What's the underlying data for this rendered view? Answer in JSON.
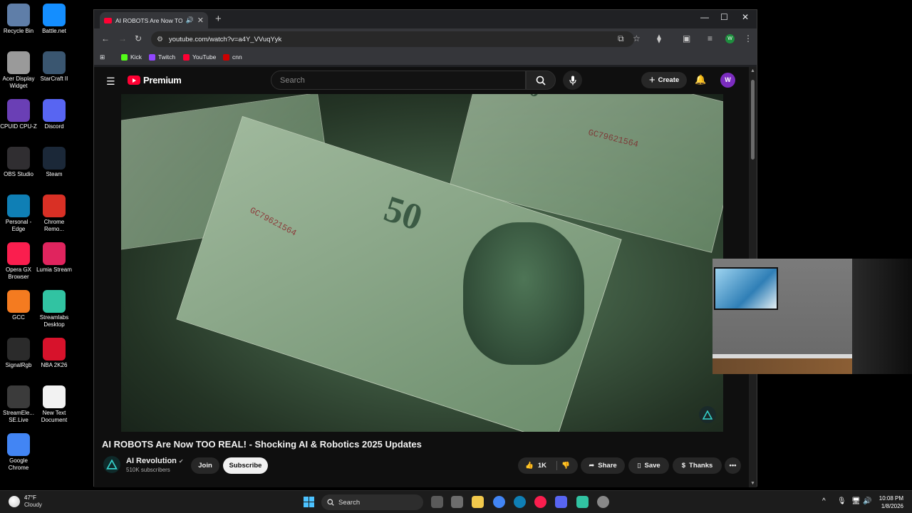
{
  "desktop": {
    "icons": [
      {
        "label": "Recycle Bin",
        "color": "#5f7ea8"
      },
      {
        "label": "Battle.net",
        "color": "#148eff"
      },
      {
        "label": "Acer Display Widget",
        "color": "#9a9a9a"
      },
      {
        "label": "StarCraft II",
        "color": "#3a5670"
      },
      {
        "label": "CPUID CPU-Z",
        "color": "#6a3fb5"
      },
      {
        "label": "Discord",
        "color": "#5865f2"
      },
      {
        "label": "OBS Studio",
        "color": "#302e31"
      },
      {
        "label": "Steam",
        "color": "#1b2838"
      },
      {
        "label": "Personal - Edge",
        "color": "#0f7fb5"
      },
      {
        "label": "Chrome Remo...",
        "color": "#d93025"
      },
      {
        "label": "Opera GX Browser",
        "color": "#fa1e4e"
      },
      {
        "label": "Lumia Stream",
        "color": "#e0245e"
      },
      {
        "label": "GCC",
        "color": "#f47b20"
      },
      {
        "label": "Streamlabs Desktop",
        "color": "#31c3a2"
      },
      {
        "label": "SignalRgb",
        "color": "#2b2b2b"
      },
      {
        "label": "NBA 2K26",
        "color": "#d7122b"
      },
      {
        "label": "StreamEle... SE.Live",
        "color": "#3b3b3b"
      },
      {
        "label": "New Text Document",
        "color": "#f2f2f2"
      },
      {
        "label": "Google Chrome",
        "color": "#4285f4"
      }
    ]
  },
  "browser": {
    "tab_title": "AI ROBOTS Are Now TOO R",
    "url": "youtube.com/watch?v=a4Y_VVuqYyk",
    "profile_letter": "W",
    "bookmarks": [
      {
        "label": "Kick",
        "color": "#53fc18"
      },
      {
        "label": "Twitch",
        "color": "#9146ff"
      },
      {
        "label": "YouTube",
        "color": "#ff0033"
      },
      {
        "label": "cnn",
        "color": "#cc0000"
      }
    ]
  },
  "youtube": {
    "logo_text": "Premium",
    "search_placeholder": "Search",
    "create_label": "Create",
    "avatar_letter": "W",
    "video": {
      "note_number": "50",
      "serial": "GC79621564"
    },
    "title": "AI ROBOTS Are Now TOO REAL! - Shocking AI & Robotics 2025 Updates",
    "channel": {
      "name": "AI Revolution",
      "subscribers": "510K subscribers"
    },
    "actions": {
      "join": "Join",
      "subscribe": "Subscribe",
      "likes": "1K",
      "share": "Share",
      "save": "Save",
      "thanks": "Thanks"
    }
  },
  "taskbar": {
    "weather_temp": "47°F",
    "weather_cond": "Cloudy",
    "search_label": "Search",
    "time": "10:08 PM",
    "date": "1/8/2026"
  }
}
